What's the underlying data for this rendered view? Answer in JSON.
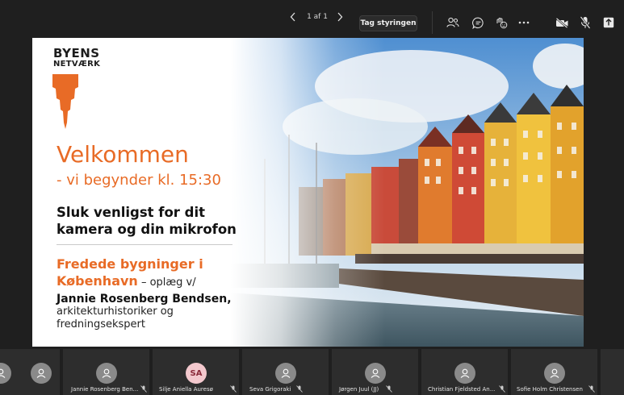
{
  "toolbar": {
    "page_indicator": "1 af 1",
    "control_button": "Tag styringen",
    "icons": [
      "chevron-left-icon",
      "chevron-right-icon",
      "people-icon",
      "chat-icon",
      "reaction-icon",
      "more-icon",
      "camera-off-icon",
      "mic-off-icon",
      "share-icon"
    ]
  },
  "slide": {
    "logo_line1": "BYENS",
    "logo_line2": "NETVÆRK",
    "welcome": "Velkommen",
    "start_time": "- vi begynder kl. 15:30",
    "mute_note": "Sluk venligst for dit kamera og din mikrofon",
    "topic": "Fredede bygninger i København",
    "topic_suffix": " – oplæg v/",
    "speaker_name": "Jannie Rosenberg Bendsen,",
    "speaker_title": "arkitekturhistoriker og fredningsekspert",
    "accent_color": "#e86b26"
  },
  "participants": [
    {
      "name": "",
      "initials": "",
      "muted": false
    },
    {
      "name": "Jannie Rosenberg Ben...",
      "initials": "",
      "muted": true
    },
    {
      "name": "Silje Aniella Auresø",
      "initials": "SA",
      "muted": true
    },
    {
      "name": "Seva Grigoraki",
      "initials": "",
      "muted": true
    },
    {
      "name": "Jørgen Juul (JJ)",
      "initials": "",
      "muted": true
    },
    {
      "name": "Christian Fjeldsted An...",
      "initials": "",
      "muted": true
    },
    {
      "name": "Sofie Holm Christensen",
      "initials": "",
      "muted": true
    }
  ]
}
